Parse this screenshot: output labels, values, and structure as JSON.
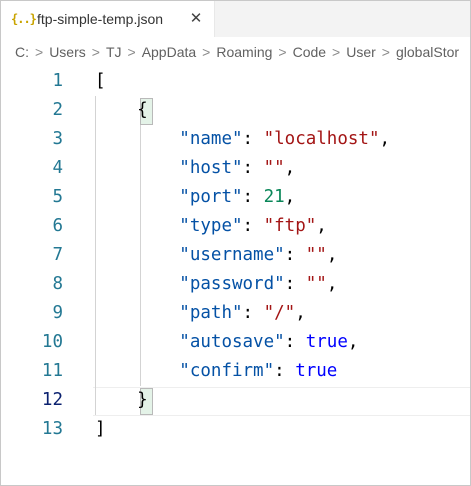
{
  "tab": {
    "icon": "{..}",
    "icon_name": "json-file-icon",
    "title": "ftp-simple-temp.json",
    "close_glyph": "✕"
  },
  "breadcrumbs": [
    "C:",
    "Users",
    "TJ",
    "AppData",
    "Roaming",
    "Code",
    "User",
    "globalStor"
  ],
  "breadcrumb_separator": ">",
  "active_line": 12,
  "lines": [
    {
      "num": "1",
      "code": "["
    },
    {
      "num": "2",
      "code": "    {"
    },
    {
      "num": "3",
      "key": "\"name\"",
      "value": "\"localhost\"",
      "type": "str",
      "comma": ","
    },
    {
      "num": "4",
      "key": "\"host\"",
      "value": "\"\"",
      "type": "str",
      "comma": ","
    },
    {
      "num": "5",
      "key": "\"port\"",
      "value": "21",
      "type": "num",
      "comma": ","
    },
    {
      "num": "6",
      "key": "\"type\"",
      "value": "\"ftp\"",
      "type": "str",
      "comma": ","
    },
    {
      "num": "7",
      "key": "\"username\"",
      "value": "\"\"",
      "type": "str",
      "comma": ","
    },
    {
      "num": "8",
      "key": "\"password\"",
      "value": "\"\"",
      "type": "str",
      "comma": ","
    },
    {
      "num": "9",
      "key": "\"path\"",
      "value": "\"/\"",
      "type": "str",
      "comma": ","
    },
    {
      "num": "10",
      "key": "\"autosave\"",
      "value": "true",
      "type": "bool",
      "comma": ","
    },
    {
      "num": "11",
      "key": "\"confirm\"",
      "value": "true",
      "type": "bool",
      "comma": ""
    },
    {
      "num": "12",
      "code": "    }"
    },
    {
      "num": "13",
      "code": "]"
    }
  ],
  "colors": {
    "key": "#0451a5",
    "string": "#a31515",
    "number": "#098658",
    "boolean": "#0000ff",
    "line_number": "#237893",
    "active_line_number": "#0b216f"
  }
}
